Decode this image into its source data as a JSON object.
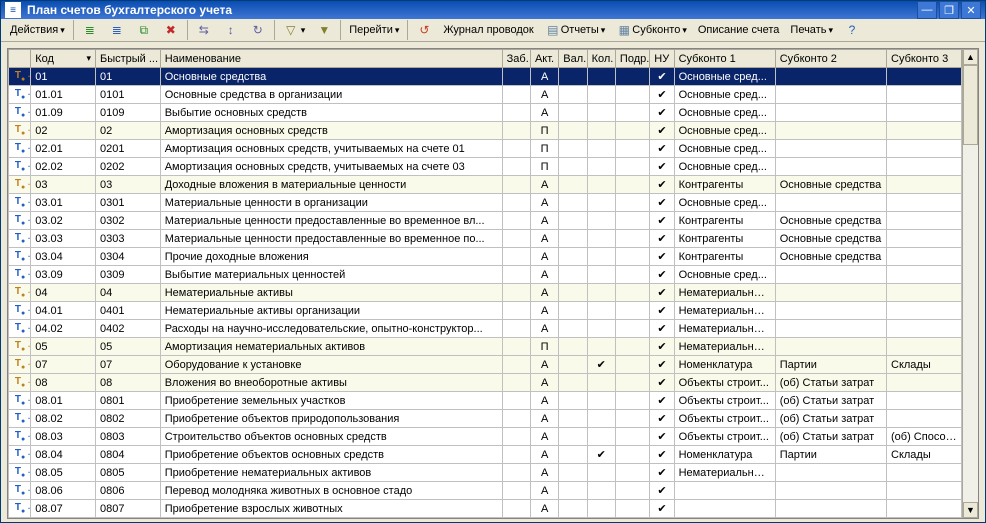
{
  "window": {
    "title": "План счетов бухгалтерского учета"
  },
  "toolbar": {
    "actions": "Действия",
    "goto": "Перейти",
    "journal": "Журнал проводок",
    "reports": "Отчеты",
    "subkonto": "Субконто",
    "desc": "Описание счета",
    "print": "Печать"
  },
  "columns": {
    "icon": "",
    "code": "Код",
    "quick": "Быстрый ...",
    "name": "Наименование",
    "zab": "Заб.",
    "akt": "Акт.",
    "val": "Вал.",
    "kol": "Кол.",
    "podr": "Подр.",
    "nu": "НУ",
    "sub1": "Субконто 1",
    "sub2": "Субконто 2",
    "sub3": "Субконто 3"
  },
  "rows": [
    {
      "sel": true,
      "parent": true,
      "code": "01",
      "quick": "01",
      "name": "Основные средства",
      "akt": "А",
      "nu": true,
      "s1": "Основные сред...",
      "s2": "",
      "s3": ""
    },
    {
      "parent": false,
      "code": "01.01",
      "quick": "0101",
      "name": "Основные средства в организации",
      "akt": "А",
      "nu": true,
      "s1": "Основные сред...",
      "s2": "",
      "s3": ""
    },
    {
      "parent": false,
      "code": "01.09",
      "quick": "0109",
      "name": "Выбытие основных средств",
      "akt": "А",
      "nu": true,
      "s1": "Основные сред...",
      "s2": "",
      "s3": ""
    },
    {
      "parent": true,
      "alt": true,
      "code": "02",
      "quick": "02",
      "name": "Амортизация основных средств",
      "akt": "П",
      "nu": true,
      "s1": "Основные сред...",
      "s2": "",
      "s3": ""
    },
    {
      "parent": false,
      "code": "02.01",
      "quick": "0201",
      "name": "Амортизация основных средств, учитываемых на счете 01",
      "akt": "П",
      "nu": true,
      "s1": "Основные сред...",
      "s2": "",
      "s3": ""
    },
    {
      "parent": false,
      "code": "02.02",
      "quick": "0202",
      "name": "Амортизация основных средств, учитываемых на счете 03",
      "akt": "П",
      "nu": true,
      "s1": "Основные сред...",
      "s2": "",
      "s3": ""
    },
    {
      "parent": true,
      "alt": true,
      "code": "03",
      "quick": "03",
      "name": "Доходные вложения в материальные ценности",
      "akt": "А",
      "nu": true,
      "s1": "Контрагенты",
      "s2": "Основные средства",
      "s3": ""
    },
    {
      "parent": false,
      "code": "03.01",
      "quick": "0301",
      "name": "Материальные ценности в организации",
      "akt": "А",
      "nu": true,
      "s1": "Основные сред...",
      "s2": "",
      "s3": ""
    },
    {
      "parent": false,
      "code": "03.02",
      "quick": "0302",
      "name": "Материальные ценности предоставленные во временное вл...",
      "akt": "А",
      "nu": true,
      "s1": "Контрагенты",
      "s2": "Основные средства",
      "s3": ""
    },
    {
      "parent": false,
      "code": "03.03",
      "quick": "0303",
      "name": "Материальные ценности предоставленные во временное по...",
      "akt": "А",
      "nu": true,
      "s1": "Контрагенты",
      "s2": "Основные средства",
      "s3": ""
    },
    {
      "parent": false,
      "code": "03.04",
      "quick": "0304",
      "name": "Прочие доходные вложения",
      "akt": "А",
      "nu": true,
      "s1": "Контрагенты",
      "s2": "Основные средства",
      "s3": ""
    },
    {
      "parent": false,
      "code": "03.09",
      "quick": "0309",
      "name": "Выбытие материальных ценностей",
      "akt": "А",
      "nu": true,
      "s1": "Основные сред...",
      "s2": "",
      "s3": ""
    },
    {
      "parent": true,
      "alt": true,
      "code": "04",
      "quick": "04",
      "name": "Нематериальные активы",
      "akt": "А",
      "nu": true,
      "s1": "Нематериальны...",
      "s2": "",
      "s3": ""
    },
    {
      "parent": false,
      "code": "04.01",
      "quick": "0401",
      "name": "Нематериальные активы организации",
      "akt": "А",
      "nu": true,
      "s1": "Нематериальны...",
      "s2": "",
      "s3": ""
    },
    {
      "parent": false,
      "code": "04.02",
      "quick": "0402",
      "name": "Расходы на научно-исследовательские, опытно-конструктор...",
      "akt": "А",
      "nu": true,
      "s1": "Нематериальны...",
      "s2": "",
      "s3": ""
    },
    {
      "parent": true,
      "alt": true,
      "code": "05",
      "quick": "05",
      "name": "Амортизация нематериальных активов",
      "akt": "П",
      "nu": true,
      "s1": "Нематериальны...",
      "s2": "",
      "s3": ""
    },
    {
      "parent": true,
      "alt": true,
      "code": "07",
      "quick": "07",
      "name": "Оборудование к установке",
      "akt": "А",
      "kol": true,
      "nu": true,
      "s1": "Номенклатура",
      "s2": "Партии",
      "s3": "Склады"
    },
    {
      "parent": true,
      "alt": true,
      "code": "08",
      "quick": "08",
      "name": "Вложения во внеоборотные активы",
      "akt": "А",
      "nu": true,
      "s1": "Объекты строит...",
      "s2": "(об) Статьи затрат",
      "s3": ""
    },
    {
      "parent": false,
      "code": "08.01",
      "quick": "0801",
      "name": "Приобретение земельных участков",
      "akt": "А",
      "nu": true,
      "s1": "Объекты строит...",
      "s2": "(об) Статьи затрат",
      "s3": ""
    },
    {
      "parent": false,
      "code": "08.02",
      "quick": "0802",
      "name": "Приобретение объектов природопользования",
      "akt": "А",
      "nu": true,
      "s1": "Объекты строит...",
      "s2": "(об) Статьи затрат",
      "s3": ""
    },
    {
      "parent": false,
      "code": "08.03",
      "quick": "0803",
      "name": "Строительство объектов основных средств",
      "akt": "А",
      "nu": true,
      "s1": "Объекты строит...",
      "s2": "(об) Статьи затрат",
      "s3": "(об) Способ..."
    },
    {
      "parent": false,
      "code": "08.04",
      "quick": "0804",
      "name": "Приобретение объектов основных средств",
      "akt": "А",
      "kol": true,
      "nu": true,
      "s1": "Номенклатура",
      "s2": "Партии",
      "s3": "Склады"
    },
    {
      "parent": false,
      "code": "08.05",
      "quick": "0805",
      "name": "Приобретение нематериальных активов",
      "akt": "А",
      "nu": true,
      "s1": "Нематериальны...",
      "s2": "",
      "s3": ""
    },
    {
      "parent": false,
      "code": "08.06",
      "quick": "0806",
      "name": "Перевод молодняка животных в основное стадо",
      "akt": "А",
      "nu": true,
      "s1": "",
      "s2": "",
      "s3": ""
    },
    {
      "parent": false,
      "code": "08.07",
      "quick": "0807",
      "name": "Приобретение взрослых животных",
      "akt": "А",
      "nu": true,
      "s1": "",
      "s2": "",
      "s3": ""
    }
  ]
}
